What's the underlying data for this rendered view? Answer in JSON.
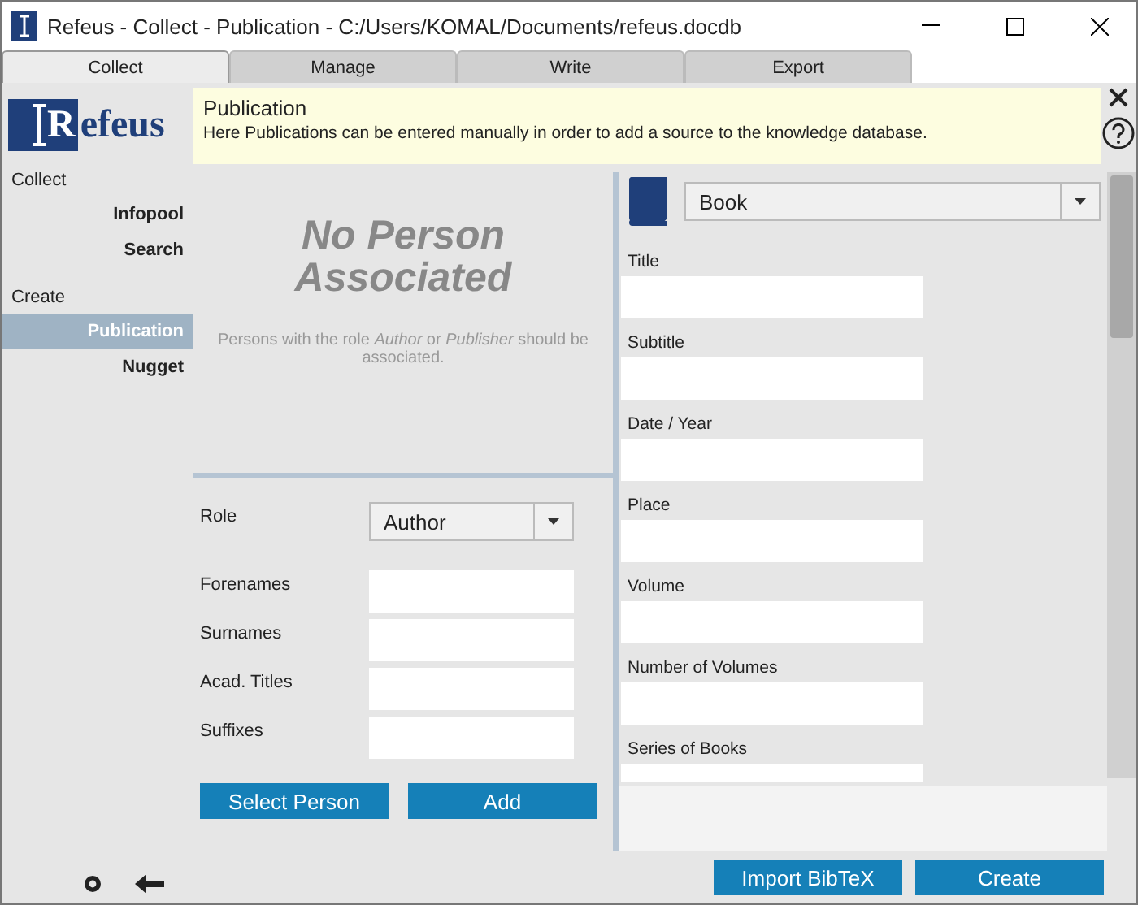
{
  "window": {
    "title": "Refeus - Collect - Publication - C:/Users/KOMAL/Documents/refeus.docdb"
  },
  "tabs": [
    {
      "label": "Collect",
      "selected": true
    },
    {
      "label": "Manage",
      "selected": false
    },
    {
      "label": "Write",
      "selected": false
    },
    {
      "label": "Export",
      "selected": false
    }
  ],
  "sidebar": {
    "logo": "Refeus",
    "sections": [
      {
        "heading": "Collect",
        "items": [
          {
            "label": "Infopool",
            "selected": false
          },
          {
            "label": "Search",
            "selected": false
          }
        ]
      },
      {
        "heading": "Create",
        "items": [
          {
            "label": "Publication",
            "selected": true
          },
          {
            "label": "Nugget",
            "selected": false
          }
        ]
      }
    ]
  },
  "banner": {
    "title": "Publication",
    "text": "Here Publications can be entered manually in order to add a source to the knowledge database."
  },
  "persons": {
    "empty_title": "No Person Associated",
    "hint": "Persons with the role *Author* or *Publisher* should be associated.",
    "role": {
      "label": "Role",
      "value": "Author"
    },
    "fields": [
      "Forenames",
      "Surnames",
      "Acad. Titles",
      "Suffixes"
    ],
    "buttons": [
      "Select Person",
      "Add"
    ]
  },
  "publication": {
    "type": "Book",
    "fields": [
      "Title",
      "Subtitle",
      "Date / Year",
      "Place",
      "Volume",
      "Number of Volumes",
      "Series of Books"
    ]
  },
  "buttons": [
    "Import BibTeX",
    "Create"
  ]
}
